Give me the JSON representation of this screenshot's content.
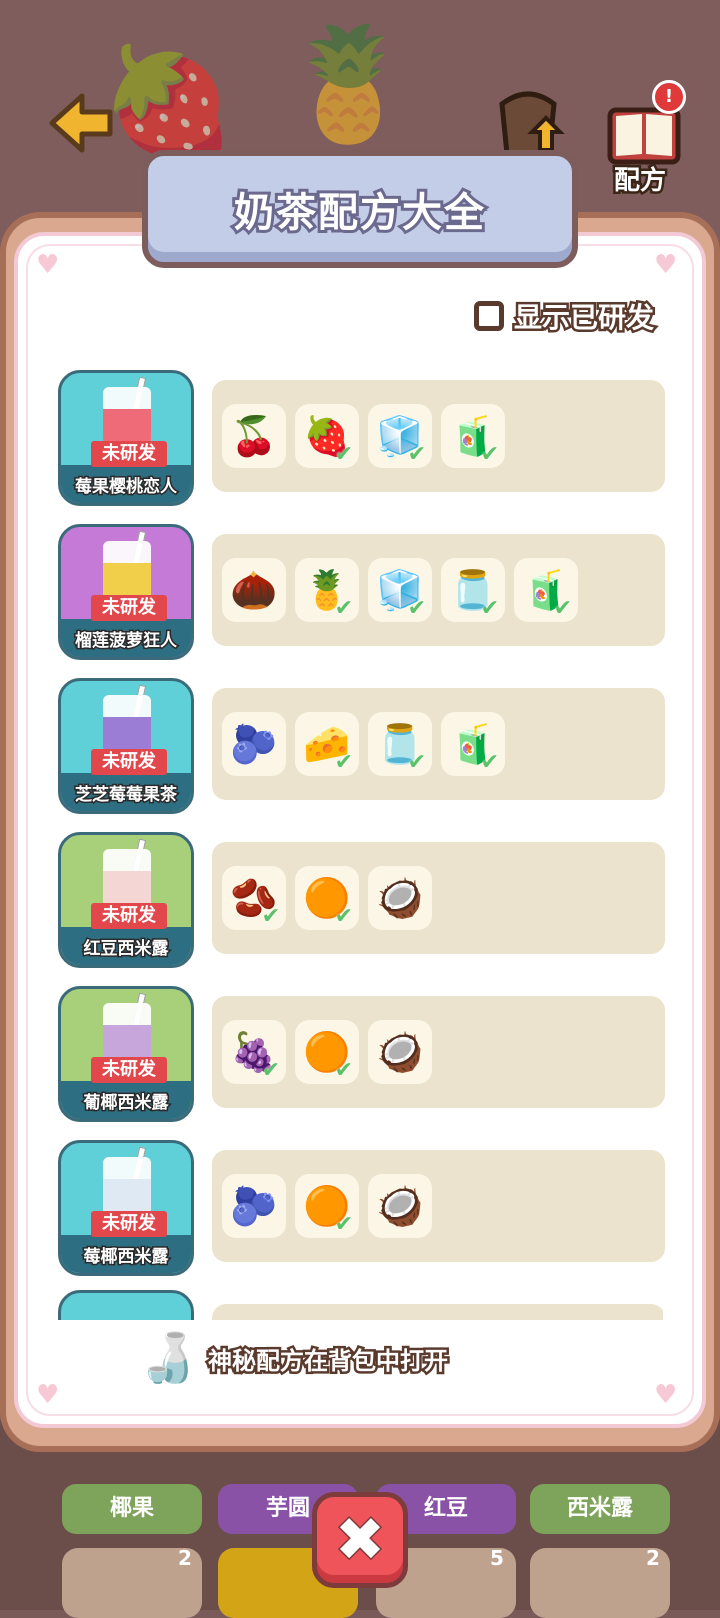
{
  "header": {
    "cup_label": "升级",
    "book_label": "配方",
    "notification": "!"
  },
  "panel": {
    "title": "奶茶配方大全",
    "show_developed_label": "显示已研发",
    "hint": "神秘配方在背包中打开"
  },
  "recipes": [
    {
      "name": "莓果樱桃恋人",
      "status": "未研发",
      "color": "#5fcfd8",
      "fill": "#f06b78",
      "ingredients": [
        {
          "icon": "🍒",
          "checked": false
        },
        {
          "icon": "🍓",
          "checked": true
        },
        {
          "icon": "🧊",
          "checked": true
        },
        {
          "icon": "🧃",
          "checked": true
        }
      ]
    },
    {
      "name": "榴莲菠萝狂人",
      "status": "未研发",
      "color": "#c67ad8",
      "fill": "#f2cf4a",
      "ingredients": [
        {
          "icon": "🌰",
          "checked": false
        },
        {
          "icon": "🍍",
          "checked": true
        },
        {
          "icon": "🧊",
          "checked": true
        },
        {
          "icon": "🫙",
          "checked": true
        },
        {
          "icon": "🧃",
          "checked": true
        }
      ]
    },
    {
      "name": "芝芝莓莓果茶",
      "status": "未研发",
      "color": "#5fcfd8",
      "fill": "#9b7dd6",
      "ingredients": [
        {
          "icon": "🫐",
          "checked": false
        },
        {
          "icon": "🧀",
          "checked": true
        },
        {
          "icon": "🫙",
          "checked": true
        },
        {
          "icon": "🧃",
          "checked": true
        }
      ]
    },
    {
      "name": "红豆西米露",
      "status": "未研发",
      "color": "#a8d07a",
      "fill": "#f4d7d4",
      "ingredients": [
        {
          "icon": "🫘",
          "checked": true
        },
        {
          "icon": "🟠",
          "checked": true
        },
        {
          "icon": "🥥",
          "checked": false
        }
      ]
    },
    {
      "name": "葡椰西米露",
      "status": "未研发",
      "color": "#a8d07a",
      "fill": "#c7a6dc",
      "ingredients": [
        {
          "icon": "🍇",
          "checked": true
        },
        {
          "icon": "🟠",
          "checked": true
        },
        {
          "icon": "🥥",
          "checked": false
        }
      ]
    },
    {
      "name": "莓椰西米露",
      "status": "未研发",
      "color": "#5fcfd8",
      "fill": "#dfe9f3",
      "ingredients": [
        {
          "icon": "🫐",
          "checked": false
        },
        {
          "icon": "🟠",
          "checked": true
        },
        {
          "icon": "🥥",
          "checked": false
        }
      ]
    }
  ],
  "bottom_tabs": [
    {
      "label": "椰果",
      "color": "#7ea35a"
    },
    {
      "label": "芋圆",
      "color": "#8a52a6"
    },
    {
      "label": "红豆",
      "color": "#8a52a6"
    },
    {
      "label": "西米露",
      "color": "#7ea35a"
    }
  ],
  "bottom_counts": [
    "2",
    "5",
    "2"
  ],
  "colors": {
    "ribbon": "#e2474c",
    "check": "#5bc26a",
    "close": "#f0545b"
  }
}
